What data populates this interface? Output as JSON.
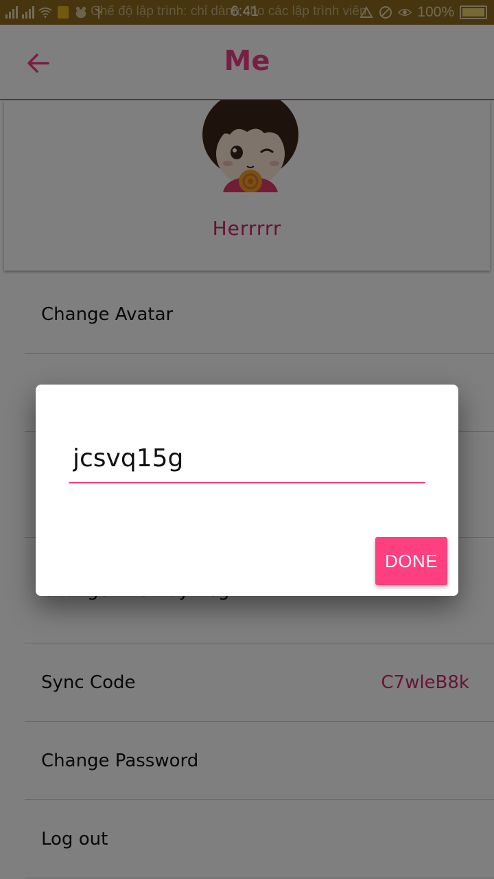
{
  "status_bar": {
    "notification_text": "Chế độ lập trình: chỉ dành cho các lập trình viên",
    "time": "6:41",
    "battery": "100%"
  },
  "app_bar": {
    "title": "Me",
    "back_icon": "arrow-left-icon"
  },
  "profile": {
    "name": "Herrrrr",
    "avatar_icon": "cartoon-girl-avatar"
  },
  "menu": [
    {
      "label": "Change Avatar",
      "value": ""
    },
    {
      "label": "",
      "value": ""
    },
    {
      "label": "",
      "value": ""
    },
    {
      "label": "Change The Day Begin",
      "value": ""
    },
    {
      "label": "Sync Code",
      "value": "C7wleB8k"
    },
    {
      "label": "Change Password",
      "value": ""
    },
    {
      "label": "Log out",
      "value": ""
    }
  ],
  "dialog": {
    "input_value": "jcsvq15g",
    "done_label": "DONE"
  },
  "colors": {
    "accent": "#ef3f86",
    "status_bar": "#8c6a1c",
    "done_button": "#ff3f80"
  }
}
